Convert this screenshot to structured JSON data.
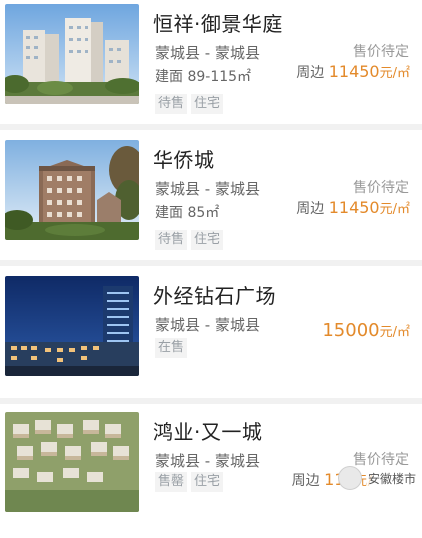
{
  "listings": [
    {
      "name": "恒祥·御景华庭",
      "location": "蒙城县 - 蒙城县",
      "area_label": "建面",
      "area_value": "89-115㎡",
      "price_status": "售价待定",
      "price_prefix": "周边",
      "price_value": "11450",
      "price_unit": "元/㎡",
      "tags": [
        "待售",
        "住宅"
      ]
    },
    {
      "name": "华侨城",
      "location": "蒙城县 - 蒙城县",
      "area_label": "建面",
      "area_value": "85㎡",
      "price_status": "售价待定",
      "price_prefix": "周边",
      "price_value": "11450",
      "price_unit": "元/㎡",
      "tags": [
        "待售",
        "住宅"
      ]
    },
    {
      "name": "外经钻石广场",
      "location": "蒙城县 - 蒙城县",
      "price_value": "15000",
      "price_unit": "元/㎡",
      "tags": [
        "在售"
      ]
    },
    {
      "name": "鸿业·又一城",
      "location": "蒙城县 - 蒙城县",
      "price_status": "售价待定",
      "price_prefix": "周边",
      "price_value": "114",
      "price_unit": "元/",
      "tags": [
        "售罄",
        "住宅"
      ]
    }
  ],
  "watermark": {
    "text": "安徽楼市"
  },
  "colors": {
    "accent": "#e38a2b",
    "tag_bg": "#f3f3f3",
    "separator": "#f1f1f1"
  }
}
